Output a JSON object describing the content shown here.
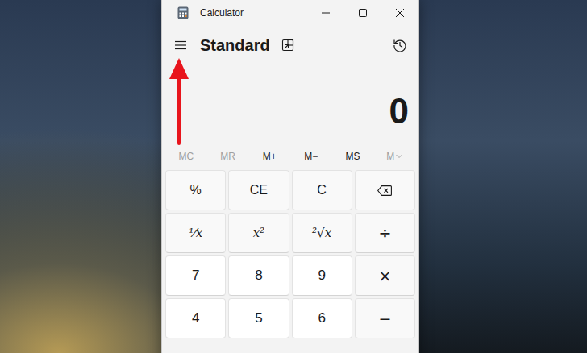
{
  "window": {
    "title": "Calculator"
  },
  "header": {
    "mode": "Standard"
  },
  "display": "0",
  "memory": [
    {
      "label": "MC",
      "disabled": true,
      "dropdown": false
    },
    {
      "label": "MR",
      "disabled": true,
      "dropdown": false
    },
    {
      "label": "M+",
      "disabled": false,
      "dropdown": false
    },
    {
      "label": "M−",
      "disabled": false,
      "dropdown": false
    },
    {
      "label": "MS",
      "disabled": false,
      "dropdown": false
    },
    {
      "label": "M",
      "disabled": true,
      "dropdown": true
    }
  ],
  "keys": [
    {
      "label": "%",
      "kind": "function"
    },
    {
      "label": "CE",
      "kind": "function"
    },
    {
      "label": "C",
      "kind": "function"
    },
    {
      "label": "",
      "kind": "backspace"
    },
    {
      "label": "⅟x",
      "kind": "math"
    },
    {
      "label": "x²",
      "kind": "math"
    },
    {
      "label": "²√x",
      "kind": "math"
    },
    {
      "label": "÷",
      "kind": "operator"
    },
    {
      "label": "7",
      "kind": "digit"
    },
    {
      "label": "8",
      "kind": "digit"
    },
    {
      "label": "9",
      "kind": "digit"
    },
    {
      "label": "×",
      "kind": "operator"
    },
    {
      "label": "4",
      "kind": "digit"
    },
    {
      "label": "5",
      "kind": "digit"
    },
    {
      "label": "6",
      "kind": "digit"
    },
    {
      "label": "−",
      "kind": "operator"
    }
  ]
}
